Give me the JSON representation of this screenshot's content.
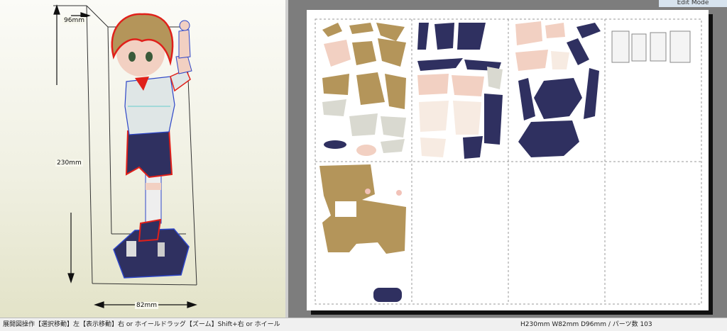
{
  "model_view": {
    "dimensions": {
      "depth": "96mm",
      "height": "230mm",
      "width": "82mm"
    }
  },
  "unfold_view": {
    "mode_button": "Edit Mode"
  },
  "status_bar": {
    "help_text": "展開図操作【選択移動】左【表示移動】右 or ホイールドラッグ【ズーム】Shift+右 or ホイール",
    "model_info": "H230mm W82mm D96mm / パーツ数 103"
  },
  "colors": {
    "hair": "#b4955a",
    "navy": "#2f3060",
    "skin": "#f2d0c2",
    "outline_red": "#e0201a",
    "outline_blue": "#2e46c8"
  }
}
